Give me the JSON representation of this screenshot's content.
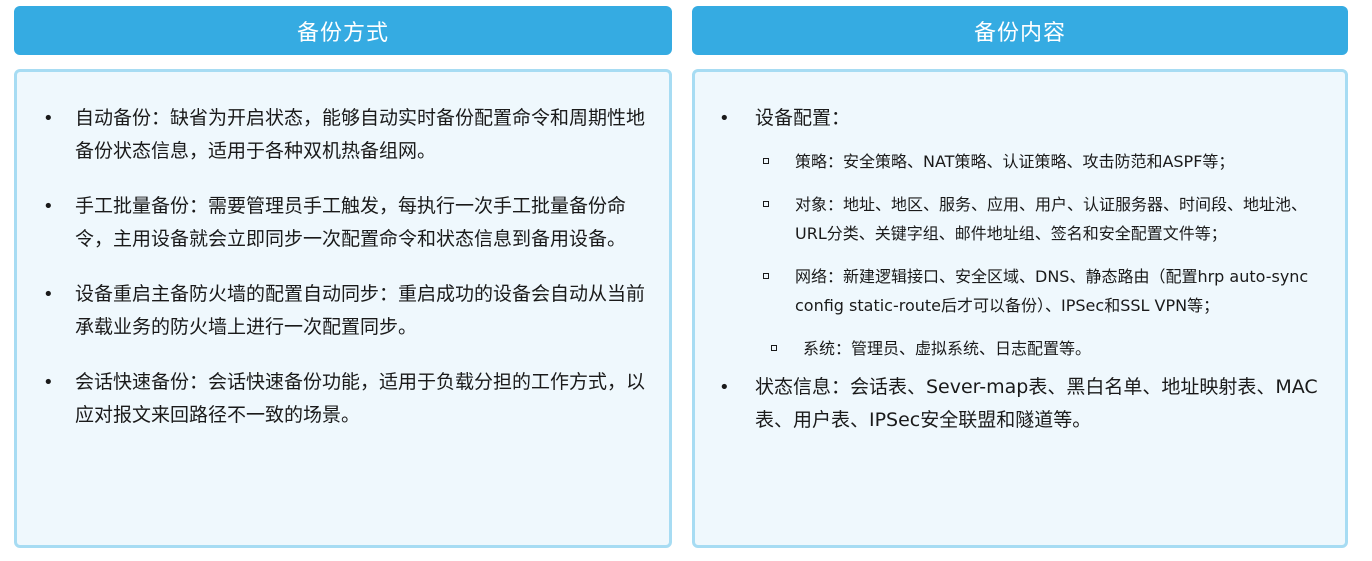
{
  "left": {
    "header": "备份方式",
    "items": [
      "自动备份：缺省为开启状态，能够自动实时备份配置命令和周期性地备份状态信息，适用于各种双机热备组网。",
      "手工批量备份：需要管理员手工触发，每执行一次手工批量备份命令，主用设备就会立即同步一次配置命令和状态信息到备用设备。",
      "设备重启主备防火墙的配置自动同步：重启成功的设备会自动从当前承载业务的防火墙上进行一次配置同步。",
      "会话快速备份：会话快速备份功能，适用于负载分担的工作方式，以应对报文来回路径不一致的场景。"
    ]
  },
  "right": {
    "header": "备份内容",
    "device_config": {
      "label": "设备配置：",
      "sub_items": [
        "策略：安全策略、NAT策略、认证策略、攻击防范和ASPF等；",
        "对象：地址、地区、服务、应用、用户、认证服务器、时间段、地址池、URL分类、关键字组、邮件地址组、签名和安全配置文件等；",
        "网络：新建逻辑接口、安全区域、DNS、静态路由（配置hrp auto-sync config static-route后才可以备份）、IPSec和SSL VPN等；",
        "系统：管理员、虚拟系统、日志配置等。"
      ]
    },
    "state_info": "状态信息：会话表、Sever-map表、黑白名单、地址映射表、MAC表、用户表、IPSec安全联盟和隧道等。"
  }
}
